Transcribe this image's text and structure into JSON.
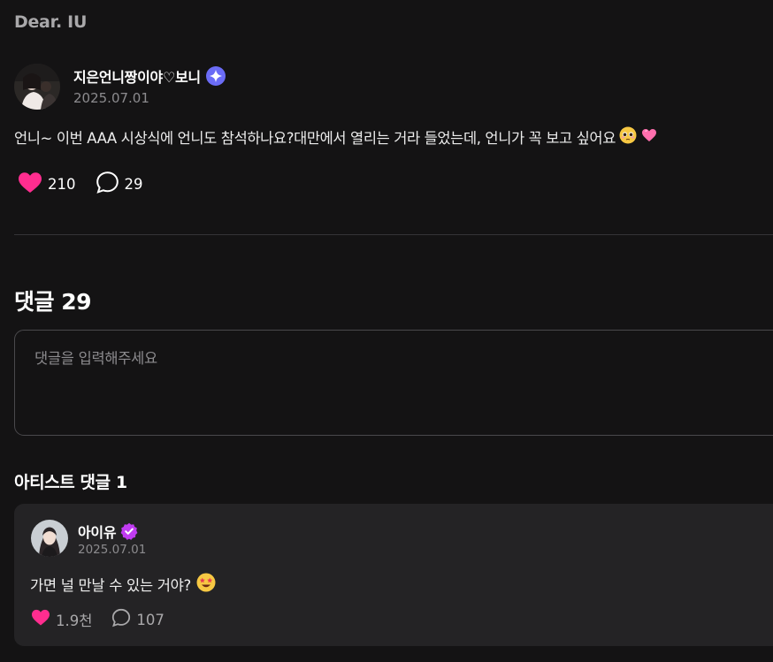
{
  "header": {
    "title": "Dear. IU"
  },
  "post": {
    "author_name": "지은언니짱이야♡보니",
    "date": "2025.07.01",
    "text": "언니~ 이번 AAA 시상식에 언니도 참석하나요?대만에서 열리는 거라 들었는데, 언니가 꼭 보고 싶어요",
    "emojis": [
      "pleading-face",
      "pink-heart"
    ],
    "likes": "210",
    "comments": "29"
  },
  "comments_section": {
    "title": "댓글 29",
    "input_placeholder": "댓글을 입력해주세요"
  },
  "artist_comments": {
    "title": "아티스트 댓글 1",
    "items": [
      {
        "author_name": "아이유",
        "date": "2025.07.01",
        "text": "가면 널 만날 수 있는 거야?",
        "emoji": "star-struck",
        "likes": "1.9천",
        "replies": "107"
      }
    ]
  },
  "colors": {
    "background": "#141314",
    "card": "#242325",
    "heart": "#ff2d8f",
    "star_badge": "#6b6cf6",
    "artist_badge": "#c13cf2",
    "muted_text": "#8c8b8e"
  },
  "icons": [
    "star-badge-icon",
    "heart-icon",
    "comment-bubble-icon",
    "verified-check-icon"
  ]
}
